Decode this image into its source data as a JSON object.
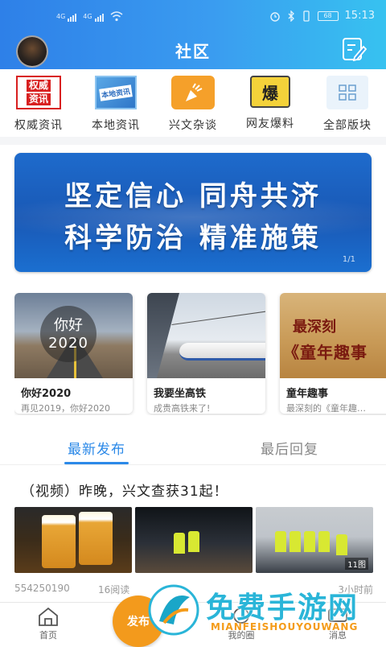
{
  "status_bar": {
    "signal1_label": "4G",
    "signal2_label": "4G",
    "battery": "68",
    "time": "15:13"
  },
  "header": {
    "title": "社区"
  },
  "categories": [
    {
      "label": "权威资讯",
      "icon": "quanwei-zixun-icon",
      "icon_text_1": "权威",
      "icon_text_2": "资讯"
    },
    {
      "label": "本地资讯",
      "icon": "bendi-zixun-icon",
      "icon_text_1": "本地资讯"
    },
    {
      "label": "兴文杂谈",
      "icon": "xingwen-zatan-icon"
    },
    {
      "label": "网友爆料",
      "icon": "baoliao-icon",
      "icon_text_1": "爆"
    },
    {
      "label": "全部版块",
      "icon": "grid-icon"
    }
  ],
  "banner": {
    "line1": "坚定信心  同舟共济",
    "line2": "科学防治  精准施策",
    "page": "1/1"
  },
  "cards": [
    {
      "title": "你好2020",
      "subtitle": "再见2019，你好2020",
      "img_text_1": "你好",
      "img_text_2": "2020"
    },
    {
      "title": "我要坐高铁",
      "subtitle": "成贵高铁来了!"
    },
    {
      "title": "童年趣事",
      "subtitle": "最深刻的《童年趣…",
      "img_text_1": "最深刻",
      "img_text_2": "《童年趣事"
    }
  ],
  "tabs": [
    {
      "label": "最新发布",
      "active": true
    },
    {
      "label": "最后回复",
      "active": false
    }
  ],
  "post": {
    "title": "（视频）昨晚，兴文查获31起！",
    "image_count": "11图",
    "author": "554250190",
    "reads": "16阅读",
    "time": "3小时前"
  },
  "bottom_nav": {
    "home": "首页",
    "publish": "发布",
    "mine": "我的圈",
    "messages": "消息"
  },
  "watermark": {
    "text": "免费手游网",
    "sub": "MIANFEISHOUYOUWANG"
  },
  "colors": {
    "accent": "#2b89e8",
    "header_start": "#2e80e8",
    "header_end": "#37c2f0",
    "publish": "#f39a1c"
  }
}
